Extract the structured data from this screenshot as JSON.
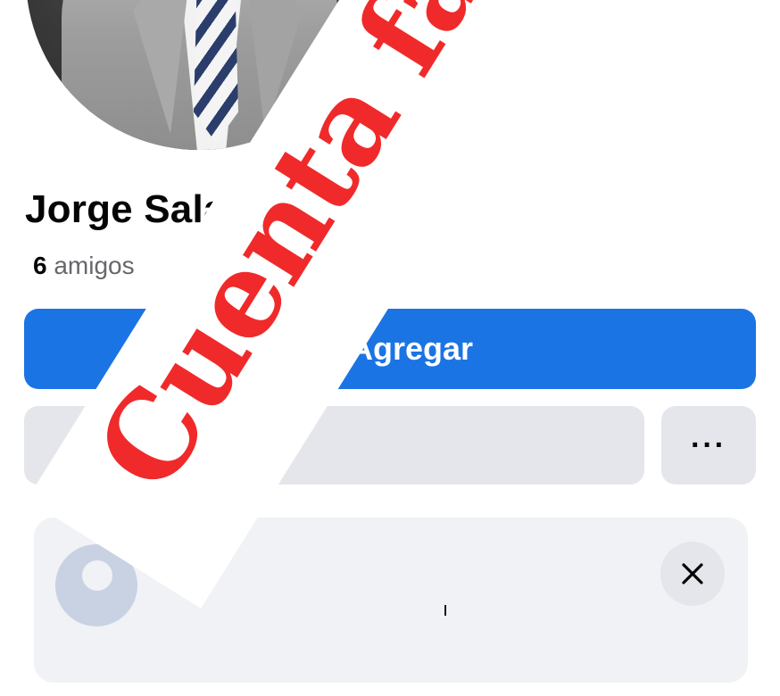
{
  "profile": {
    "name": "Jorge Salazar Acosta",
    "friends_count": "6",
    "friends_label": "amigos"
  },
  "actions": {
    "add_label": "Agregar",
    "more_label": "···"
  },
  "card": {
    "snippet": "ı"
  },
  "overlay": {
    "stamp_text": "Cuenta falsa",
    "stamp_color": "#f02a2a"
  },
  "colors": {
    "primary": "#1b74e4",
    "secondary_button": "#e4e6eb"
  }
}
